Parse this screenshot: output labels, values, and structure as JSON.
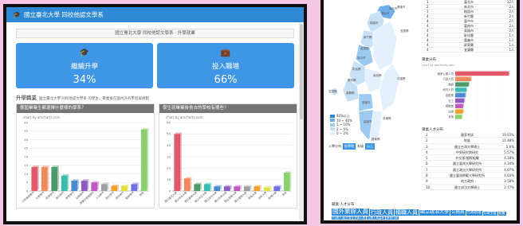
{
  "app": {
    "header_title": "國立臺北大學 同校他認文學系",
    "sub_text": "國立臺北大學 同校他認文學系 · 升學就業"
  },
  "tiles": [
    {
      "label": "繼續升學",
      "value": "34%",
      "icon": "graduation-cap-icon"
    },
    {
      "label": "投入職場",
      "value": "66%",
      "icon": "briefcase-icon"
    }
  ],
  "path_section": {
    "title": "升學職業",
    "subtitle": "國立臺北大學 同校他認文學系 的學生，畢業後在國內外的學習與規劃"
  },
  "chart_left_title": "應屆畢業生都選擇什麼樣的學系？",
  "chart_right_title": "學生就畢業後會去的學校有哪些？",
  "chart_credit": "chart by amcharts.com",
  "chart_data": [
    {
      "type": "bar",
      "title": "應屆畢業生都選擇什麼樣的學系？",
      "categories": [
        "公共事務學門",
        "社會學門",
        "經濟學門",
        "語文學門",
        "教育學門",
        "法律學門",
        "商業及管理學門",
        "人文學門",
        "設計學門",
        "資訊學門",
        "藝術學門",
        "其他"
      ],
      "values": [
        14,
        14,
        14,
        9,
        6,
        6,
        5,
        4,
        3,
        3,
        4,
        36
      ],
      "colors": [
        "#e05a6a",
        "#f08a5d",
        "#4e9a6a",
        "#3cbcb0",
        "#4a88d0",
        "#8a5cc0",
        "#c05ac0",
        "#a0a0a0",
        "#f0a030",
        "#e0e040",
        "#7070e0",
        "#8ccf70"
      ],
      "ylim": [
        0,
        40
      ],
      "yticks": [
        0,
        5,
        10,
        15,
        20,
        25,
        30,
        35,
        40
      ]
    },
    {
      "type": "bar",
      "title": "學生就畢業後會去的學校有哪些？",
      "categories": [
        "國立臺北大學",
        "國立政治大學",
        "國立臺灣大學",
        "國立中正大學",
        "國立成功大學",
        "國立中興大學",
        "國立清華大學",
        "國立暨南大學",
        "東吳大學",
        "世新大學",
        "銘傳大學",
        "其他"
      ],
      "values": [
        50,
        11,
        6,
        6,
        4,
        4,
        4,
        4,
        4,
        3,
        4,
        16
      ],
      "colors": [
        "#e05a6a",
        "#f08a5d",
        "#4e9a6a",
        "#3cbcb0",
        "#4a88d0",
        "#8a5cc0",
        "#c05ac0",
        "#a0a0a0",
        "#f0a030",
        "#e0e040",
        "#7070e0",
        "#8ccf70"
      ],
      "ylim": [
        0,
        60
      ],
      "yticks": [
        0,
        10,
        20,
        30,
        40,
        50,
        60
      ]
    }
  ],
  "right_panel": {
    "rank_rows": [
      {
        "n": "1",
        "name": "臺北市",
        "v": "12人"
      },
      {
        "n": "2",
        "name": "新北市",
        "v": "2人"
      },
      {
        "n": "3",
        "name": "桃園市",
        "v": "2人"
      },
      {
        "n": "4",
        "name": "新竹縣",
        "v": "2人"
      },
      {
        "n": "4",
        "name": "臺中市",
        "v": "2人"
      },
      {
        "n": "4",
        "name": "臺南市",
        "v": "2人"
      },
      {
        "n": "4",
        "name": "高雄市",
        "v": "2人"
      },
      {
        "n": "4",
        "name": "彰化縣",
        "v": "1人"
      },
      {
        "n": "4",
        "name": "嘉義市",
        "v": "1人"
      },
      {
        "n": "4",
        "name": "屏東縣",
        "v": "1人"
      },
      {
        "n": "4",
        "name": "宜蘭縣",
        "v": "1人"
      }
    ],
    "legend": [
      "40%以上",
      "10 ~ 40%",
      "5 ~ 10%",
      "2 ~ 5%",
      "0 ~ 2%"
    ],
    "legend_colors": [
      "#2f88d4",
      "#6fb0e8",
      "#9ccaf0",
      "#c6e0f6",
      "#e4f0fb"
    ],
    "map_controls": {
      "label": "入學分布",
      "btn1": "依學院",
      "btn2": "系級",
      "more": "以上"
    },
    "map_labels": [
      "新北市",
      "臺北市",
      "基隆市",
      "桃園市",
      "新竹縣",
      "苗栗縣",
      "臺中市",
      "彰化縣",
      "南投縣",
      "雲林縣",
      "嘉義縣",
      "臺南市",
      "高雄市",
      "屏東縣",
      "宜蘭縣",
      "花蓮縣",
      "臺東縣",
      "澎湖縣"
    ],
    "dist_title": "畢業分布",
    "dist_credit": "chart by amcharts.com",
    "dist_bars": [
      {
        "label": "國家公務人員",
        "value": 48,
        "color": "#e05a6a"
      },
      {
        "label": "行政人員",
        "value": 14,
        "color": "#f08a5d"
      },
      {
        "label": "教師",
        "value": 12,
        "color": "#4e9a6a"
      },
      {
        "label": "研究人員",
        "value": 10,
        "color": "#3cbcb0"
      },
      {
        "label": "金融業",
        "value": 9,
        "color": "#4a88d0"
      },
      {
        "label": "社工",
        "value": 8,
        "color": "#8a5cc0"
      },
      {
        "label": "媒體業",
        "value": 7,
        "color": "#c05ac0"
      },
      {
        "label": "法律",
        "value": 7,
        "color": "#f0a030"
      },
      {
        "label": "其他",
        "value": 6,
        "color": "#8ccf70"
      }
    ],
    "hot_title": "畢業人才分布",
    "hot_rows": [
      {
        "n": "1",
        "name": "國家考試",
        "v": "19.93%"
      },
      {
        "n": "2",
        "name": "地區",
        "v": "11.48%"
      },
      {
        "n": "3",
        "name": "國立台灣大學碩士",
        "v": "5.6%"
      },
      {
        "n": "4",
        "name": "中央研究院研究",
        "v": "5.57%"
      },
      {
        "n": "5",
        "name": "外交部/國際組織",
        "v": "4.18%"
      },
      {
        "n": "6",
        "name": "國立臺灣大學研究所",
        "v": "4.34%"
      },
      {
        "n": "7",
        "name": "國立政治大學研究所",
        "v": "4.07%"
      },
      {
        "n": "8",
        "name": "國立臺灣師範大學研究所",
        "v": "4.03%"
      },
      {
        "n": "9",
        "name": "地方政府",
        "v": "3.58%"
      },
      {
        "n": "10",
        "name": "國立成功大學碩士",
        "v": "2.77%"
      }
    ],
    "univ_title": "職業·人才分布",
    "univ_tags": [
      {
        "t": "國外業餘人員",
        "s": 7.5
      },
      {
        "t": "行政人員",
        "s": 7
      },
      {
        "t": "稱職人員",
        "s": 7
      },
      {
        "t": "國立政治大學",
        "s": 6
      },
      {
        "t": "公務員",
        "s": 5.5
      },
      {
        "t": "行政助理",
        "s": 4.5
      },
      {
        "t": "行政主管",
        "s": 4
      },
      {
        "t": "秘書",
        "s": 4
      },
      {
        "t": "行政人員主管",
        "s": 4
      },
      {
        "t": "法律人員",
        "s": 3.5
      },
      {
        "t": "公務人員高考",
        "s": 3.5
      },
      {
        "t": "教育行政",
        "s": 3.5
      }
    ]
  }
}
